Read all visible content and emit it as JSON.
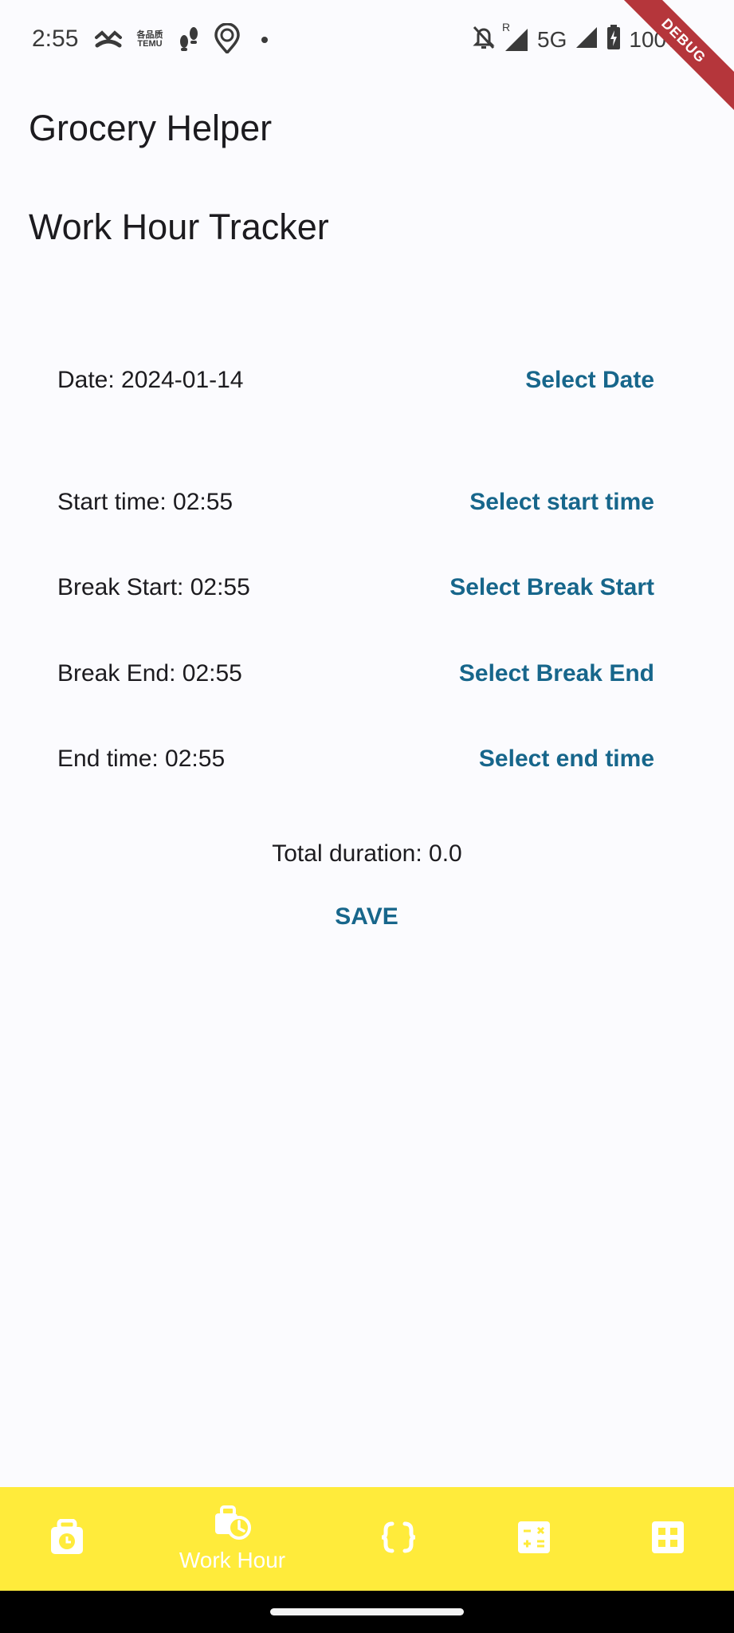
{
  "status_bar": {
    "time": "2:55",
    "left_icons": [
      "missed-call-icon",
      "temu-icon",
      "footsteps-icon",
      "location-pin-icon",
      "dot-icon"
    ],
    "temu_text_top": "各品质",
    "temu_text_bottom": "TEMU",
    "network": "5G",
    "roaming": "R",
    "battery": "100%"
  },
  "debug_ribbon": "DEBUG",
  "app_title": "Grocery Helper",
  "page_title": "Work Hour Tracker",
  "rows": [
    {
      "label": "Date: 2024-01-14",
      "button": "Select Date"
    },
    {
      "label": "Start time: 02:55",
      "button": "Select start time"
    },
    {
      "label": "Break Start: 02:55",
      "button": "Select Break Start"
    },
    {
      "label": "Break End: 02:55",
      "button": "Select Break End"
    },
    {
      "label": "End time: 02:55",
      "button": "Select end time"
    }
  ],
  "total": "Total duration: 0.0",
  "save_label": "SAVE",
  "bottom_nav": {
    "items": [
      {
        "icon": "timer-bag-icon",
        "label": ""
      },
      {
        "icon": "work-hour-icon",
        "label": "Work Hour"
      },
      {
        "icon": "code-braces-icon",
        "label": ""
      },
      {
        "icon": "calculator-icon",
        "label": ""
      },
      {
        "icon": "grid-icon",
        "label": ""
      }
    ]
  },
  "colors": {
    "accent": "#17668b",
    "background": "#fbfbfe",
    "nav_background": "#ffeb3b",
    "nav_icon": "#ffffff",
    "debug_ribbon": "#b5363b"
  }
}
